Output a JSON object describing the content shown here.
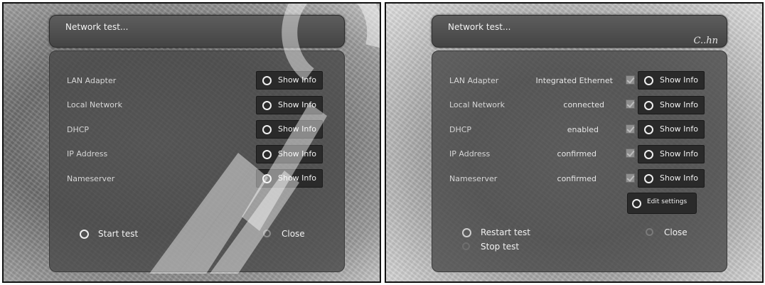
{
  "left": {
    "title": "Network test...",
    "rows": [
      {
        "label": "LAN Adapter",
        "button": "Show Info"
      },
      {
        "label": "Local Network",
        "button": "Show Info"
      },
      {
        "label": "DHCP",
        "button": "Show Info"
      },
      {
        "label": "IP Address",
        "button": "Show Info"
      },
      {
        "label": "Nameserver",
        "button": "Show Info"
      }
    ],
    "start_label": "Start test",
    "close_label": "Close"
  },
  "right": {
    "title": "Network test...",
    "logo_text": "C..hn",
    "rows": [
      {
        "label": "LAN Adapter",
        "value": "Integrated Ethernet",
        "button": "Show Info"
      },
      {
        "label": "Local Network",
        "value": "connected",
        "button": "Show Info"
      },
      {
        "label": "DHCP",
        "value": "enabled",
        "button": "Show Info"
      },
      {
        "label": "IP Address",
        "value": "confirmed",
        "button": "Show Info"
      },
      {
        "label": "Nameserver",
        "value": "confirmed",
        "button": "Show Info"
      }
    ],
    "edit_label": "Edit settings",
    "restart_label": "Restart test",
    "stop_label": "Stop test",
    "close_label": "Close"
  }
}
